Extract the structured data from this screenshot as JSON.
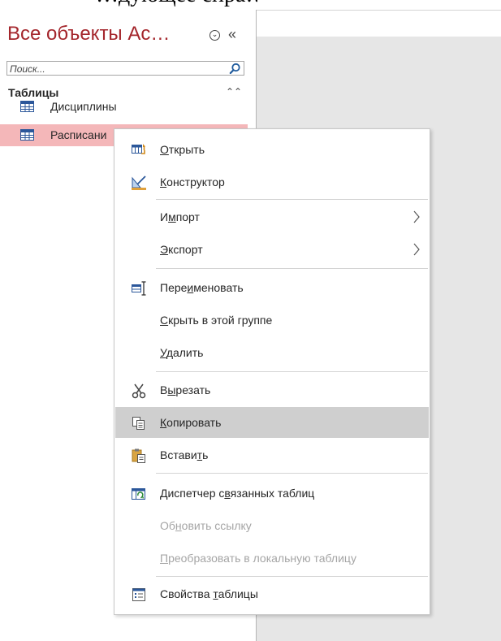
{
  "doc_fragment": "…дующее спра…",
  "nav_pane": {
    "title": "Все объекты Ac…",
    "menu_glyph": "⌄",
    "shutter_glyph": "«",
    "search": {
      "placeholder": "Поиск...",
      "value": ""
    },
    "group": {
      "label": "Таблицы",
      "collapse_glyph": "⌃⌃"
    },
    "items": [
      {
        "label": "Дисциплины",
        "selected": false
      },
      {
        "label": "Расписани",
        "selected": true
      }
    ],
    "selected_color": "#f4b7b9",
    "title_color": "#a4262c"
  },
  "context_menu": {
    "items": [
      {
        "pre": "",
        "acc": "О",
        "post": "ткрыть",
        "icon": "open-table-icon",
        "disabled": false
      },
      {
        "pre": "",
        "acc": "К",
        "post": "онструктор",
        "icon": "design-view-icon",
        "disabled": false
      },
      {
        "pre": "И",
        "acc": "м",
        "post": "порт",
        "icon": "",
        "submenu": true,
        "disabled": false
      },
      {
        "pre": "",
        "acc": "Э",
        "post": "кспорт",
        "icon": "",
        "submenu": true,
        "disabled": false
      },
      {
        "pre": "Пере",
        "acc": "и",
        "post": "меновать",
        "icon": "rename-icon",
        "disabled": false
      },
      {
        "pre": "",
        "acc": "С",
        "post": "крыть в этой группе",
        "icon": "",
        "disabled": false
      },
      {
        "pre": "",
        "acc": "У",
        "post": "далить",
        "icon": "",
        "disabled": false
      },
      {
        "pre": "В",
        "acc": "ы",
        "post": "резать",
        "icon": "scissors-icon",
        "disabled": false
      },
      {
        "pre": "",
        "acc": "К",
        "post": "опировать",
        "icon": "copy-icon",
        "disabled": false,
        "hover": true
      },
      {
        "pre": "Встави",
        "acc": "т",
        "post": "ь",
        "icon": "paste-icon",
        "disabled": false
      },
      {
        "pre": "Диспетчер с",
        "acc": "в",
        "post": "язанных таблиц",
        "icon": "linked-table-manager-icon",
        "disabled": false
      },
      {
        "pre": "Об",
        "acc": "н",
        "post": "овить ссылку",
        "icon": "",
        "disabled": true
      },
      {
        "pre": "",
        "acc": "П",
        "post": "реобразовать в локальную таблицу",
        "icon": "",
        "disabled": true
      },
      {
        "pre": "Свойства ",
        "acc": "т",
        "post": "аблицы",
        "icon": "table-properties-icon",
        "disabled": false
      }
    ],
    "hover_color": "#cfcfcf"
  }
}
